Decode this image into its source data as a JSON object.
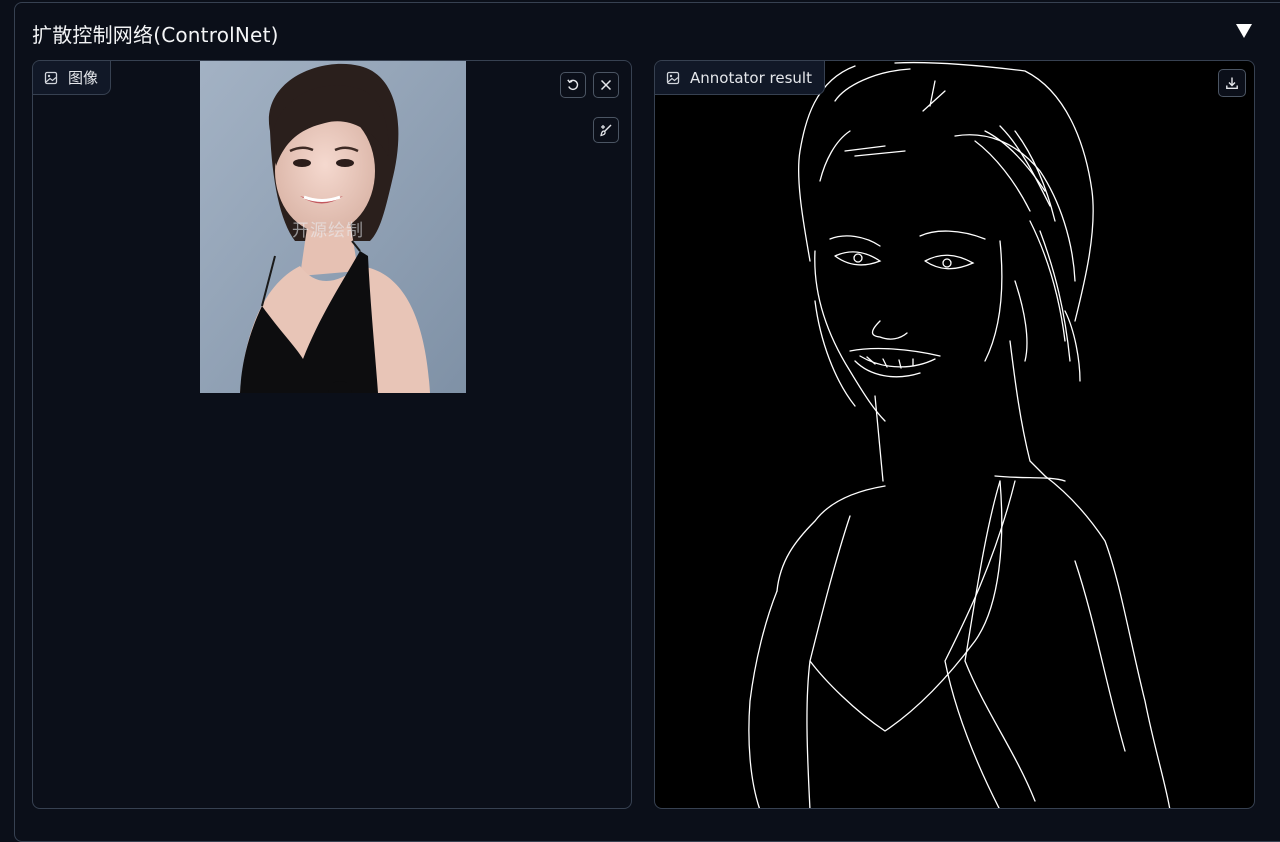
{
  "accordion": {
    "title": "扩散控制网络(ControlNet)",
    "toggle_icon": "triangle-down-icon"
  },
  "input_panel": {
    "label": "图像",
    "label_icon": "image-icon",
    "buttons": {
      "undo_icon": "undo-icon",
      "clear_icon": "close-icon",
      "brush_icon": "brush-icon"
    },
    "watermark": "开源绘制"
  },
  "output_panel": {
    "label": "Annotator result",
    "label_icon": "image-icon",
    "buttons": {
      "download_icon": "download-icon"
    }
  },
  "colors": {
    "background": "#0b0f19",
    "border": "#374151",
    "chip": "#111827",
    "result_bg": "#000000",
    "photo_bg": "#93a3b6",
    "edge_line": "#ffffff"
  }
}
